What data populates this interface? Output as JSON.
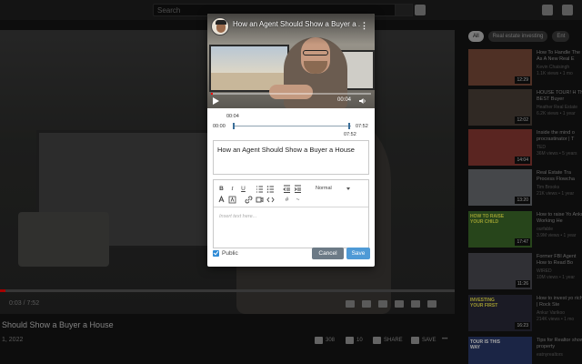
{
  "youtube": {
    "search_placeholder": "Search",
    "player_time": "0:03 / 7:52",
    "video_title": "Should Show a Buyer a House",
    "upload_date": "1, 2022",
    "like_count": "308",
    "dislike_count": "10",
    "share_label": "SHARE",
    "save_label": "SAVE",
    "chips": [
      "All",
      "Real estate investing",
      "Ent"
    ],
    "recommendations": [
      {
        "title": "How To Handle The",
        "line2": "As A New Real E",
        "channel": "Kevin Chaisingh",
        "meta": "1.1K views • 1 mo",
        "duration": "12:29"
      },
      {
        "title": "HOUSE TOUR! H",
        "line2": "The BEST Buyer",
        "channel": "Heather Real Estate",
        "meta": "6.2K views • 1 year",
        "duration": "12:02"
      },
      {
        "title": "Inside the mind o",
        "line2": "procrastinator | T",
        "channel": "TED",
        "meta": "36M views • 5 years",
        "duration": "14:04"
      },
      {
        "title": "Real Estate Tra",
        "line2": "Process Flowcha",
        "channel": "Tim Brooks",
        "meta": "21K views • 1 year",
        "duration": "13:20"
      },
      {
        "title": "How to raise Yo",
        "line2": "Ankur Working He",
        "channel": "ourfable",
        "meta": "3.9M views • 1 year",
        "duration": "17:47"
      },
      {
        "title": "Former FBI Agent",
        "line2": "How to Read Bo",
        "channel": "WIRED",
        "meta": "10M views • 1 year",
        "duration": "11:26"
      },
      {
        "title": "How to invest yo",
        "line2": "rich? | Rock Ste",
        "channel": "Ankur Varikoo",
        "meta": "214K views • 1 mo",
        "duration": "16:23"
      },
      {
        "title": "Tips for Realtor",
        "line2": "show property",
        "channel": "eatnyrealtors",
        "meta": "",
        "duration": ""
      }
    ],
    "rec_thumb_texts": [
      "",
      "",
      "",
      "",
      "HOW TO RAISE YOUR CHILD",
      "",
      "INVESTING YOUR FIRST",
      "TOUR IS THIS WAY"
    ]
  },
  "modal": {
    "video_title": "How an Agent Should Show a Buyer a ...",
    "more_icon": "⋮",
    "player_time": "00:04",
    "trim": {
      "current": "00:04",
      "start": "00:00",
      "end": "07:52",
      "end_below": "07:52"
    },
    "title_value": "How an Agent Should Show a Buyer a House",
    "toolbar": {
      "bold": "B",
      "italic": "I",
      "underline": "U",
      "format_select": "Normal"
    },
    "editor_placeholder": "Insert text here...",
    "public_label": "Public",
    "cancel_label": "Cancel",
    "save_label": "Save",
    "colors": {
      "cancel": "#6c7a86",
      "save": "#4f9ad6",
      "checkbox": "#2f8bd6"
    }
  }
}
